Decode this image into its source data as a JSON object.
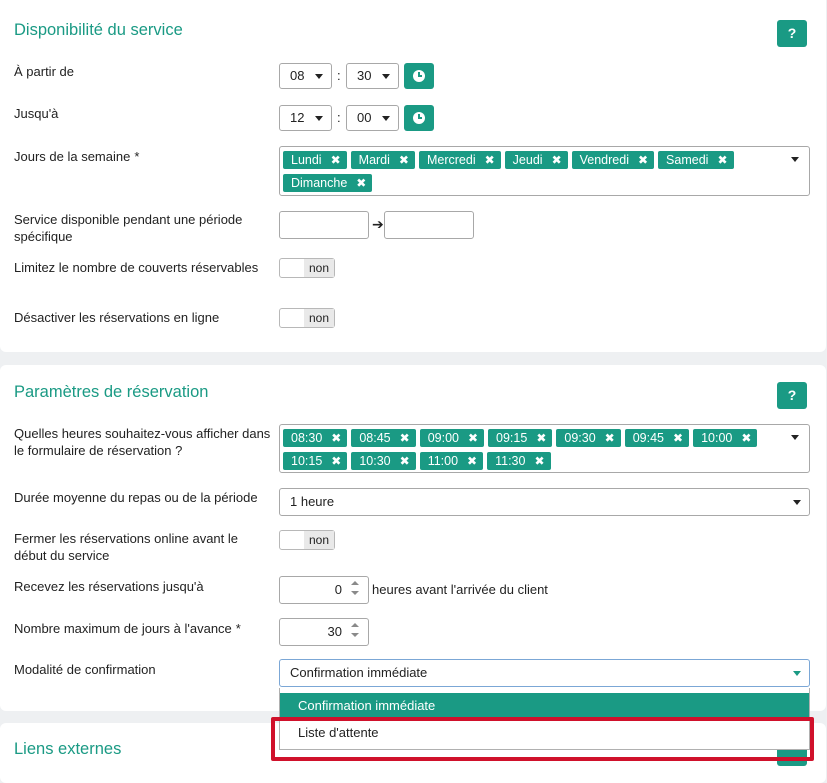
{
  "availability": {
    "title": "Disponibilité du service",
    "help": "?",
    "from_label": "À partir de",
    "from_hour": "08",
    "from_minute": "30",
    "until_label": "Jusqu'à",
    "until_hour": "12",
    "until_minute": "00",
    "colon": ":",
    "days_label": "Jours de la semaine",
    "required_mark": "*",
    "days": [
      "Lundi",
      "Mardi",
      "Mercredi",
      "Jeudi",
      "Vendredi",
      "Samedi",
      "Dimanche"
    ],
    "tag_remove": "✖",
    "period_label": "Service disponible pendant une période spécifique",
    "arrow": "➔",
    "limit_label": "Limitez le nombre de couverts réservables",
    "limit_value": "non",
    "disable_label": "Désactiver les réservations en ligne",
    "disable_value": "non"
  },
  "booking": {
    "title": "Paramètres de réservation",
    "help": "?",
    "hours_label": "Quelles heures souhaitez-vous afficher dans le formulaire de réservation ?",
    "hours": [
      "08:30",
      "08:45",
      "09:00",
      "09:15",
      "09:30",
      "09:45",
      "10:00",
      "10:15",
      "10:30",
      "11:00",
      "11:30"
    ],
    "duration_label": "Durée moyenne du repas ou de la période",
    "duration_value": "1 heure",
    "close_label": "Fermer les réservations online avant le début du service",
    "close_value": "non",
    "receive_label": "Recevez les réservations jusqu'à",
    "receive_value": "0",
    "receive_suffix": "heures avant l'arrivée du client",
    "max_days_label": "Nombre maximum de jours à l'avance",
    "max_days_value": "30",
    "confirm_label": "Modalité de confirmation",
    "confirm_value": "Confirmation immédiate",
    "confirm_options": [
      "Confirmation immédiate",
      "Liste d'attente"
    ]
  },
  "links": {
    "title": "Liens externes"
  },
  "colors": {
    "accent": "#1a9a84",
    "highlight": "#d0112b"
  }
}
